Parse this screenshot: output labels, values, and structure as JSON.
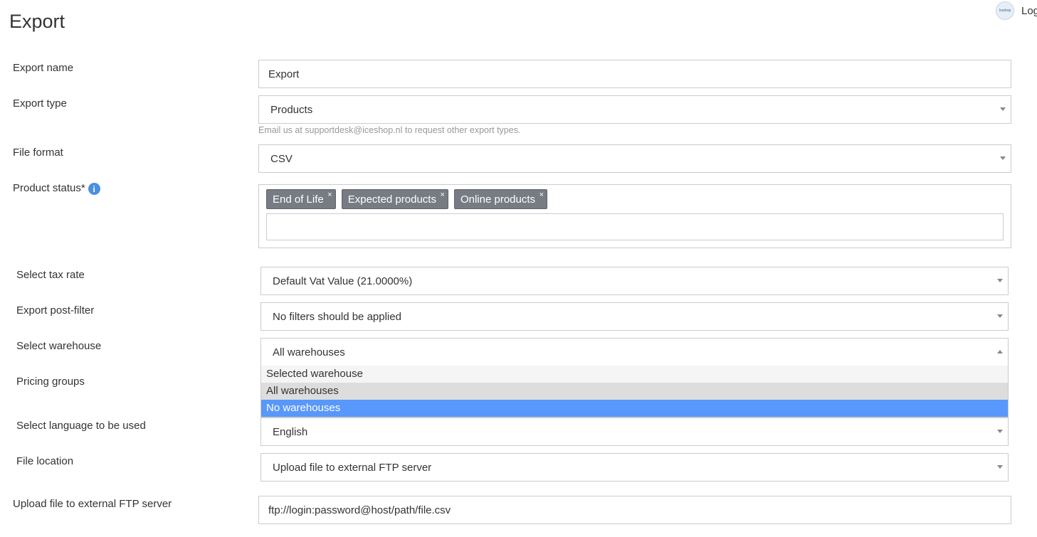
{
  "header": {
    "title": "Export",
    "logout_label": "Log",
    "avatar_text": "Iceshop"
  },
  "form": {
    "export_name": {
      "label": "Export name",
      "value": "Export"
    },
    "export_type": {
      "label": "Export type",
      "value": "Products",
      "help": "Email us at supportdesk@iceshop.nl to request other export types."
    },
    "file_format": {
      "label": "File format",
      "value": "CSV"
    },
    "product_status": {
      "label": "Product status*",
      "info_icon": "i",
      "tags": [
        "End of Life",
        "Expected products",
        "Online products"
      ],
      "remove_symbol": "×"
    },
    "tax_rate": {
      "label": "Select tax rate",
      "value": "Default Vat Value (21.0000%)"
    },
    "post_filter": {
      "label": "Export post-filter",
      "value": "No filters should be applied"
    },
    "warehouse": {
      "label": "Select warehouse",
      "value": "All warehouses",
      "options": [
        "Selected warehouse",
        "All warehouses",
        "No warehouses"
      ]
    },
    "pricing_groups": {
      "label": "Pricing groups"
    },
    "language": {
      "label": "Select language to be used",
      "value": "English"
    },
    "file_location": {
      "label": "File location",
      "value": "Upload file to external FTP server"
    },
    "ftp": {
      "label": "Upload file to external FTP server",
      "value": "ftp://login:password@host/path/file.csv"
    }
  },
  "colors": {
    "highlight": "#5897fb",
    "tag_bg": "#767b84",
    "info": "#4a90e2"
  }
}
